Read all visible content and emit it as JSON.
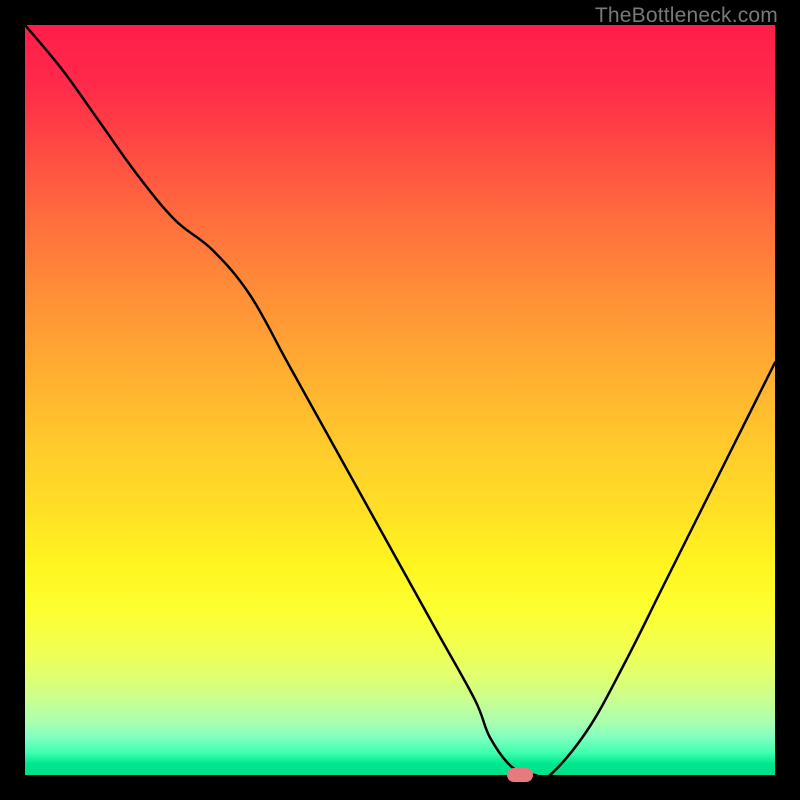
{
  "watermark": "TheBottleneck.com",
  "chart_data": {
    "type": "line",
    "title": "",
    "xlabel": "",
    "ylabel": "",
    "xlim": [
      0,
      100
    ],
    "ylim": [
      0,
      100
    ],
    "grid": false,
    "series": [
      {
        "name": "bottleneck-curve",
        "x": [
          0,
          5,
          10,
          15,
          20,
          25,
          30,
          35,
          40,
          45,
          50,
          55,
          60,
          62,
          65,
          68,
          70,
          75,
          80,
          85,
          90,
          95,
          100
        ],
        "values": [
          100,
          94,
          87,
          80,
          74,
          70,
          64,
          55,
          46,
          37,
          28,
          19,
          10,
          5,
          1,
          0,
          0,
          6,
          15,
          25,
          35,
          45,
          55
        ]
      }
    ],
    "marker": {
      "x": 66,
      "y": 0,
      "color": "#e67a7f"
    },
    "background_gradient": {
      "top": "#ff1e4a",
      "mid": "#ffe026",
      "bottom": "#00df88"
    }
  }
}
